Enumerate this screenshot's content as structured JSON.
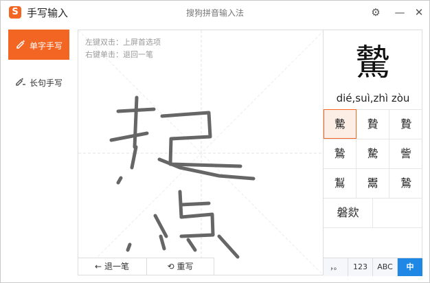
{
  "app": {
    "title": "手写输入",
    "logo": "S",
    "window_title": "搜狗拼音输入法"
  },
  "titlebar": {
    "settings_icon": "gear-icon",
    "minimize_icon": "minimize-icon",
    "close_icon": "close-icon",
    "minimize_glyph": "—",
    "close_glyph": "✕",
    "settings_glyph": "⚙"
  },
  "sidebar": {
    "items": [
      {
        "label": "单字手写",
        "icon": "pen-icon",
        "active": true
      },
      {
        "label": "长句手写",
        "icon": "sentence-pen-icon",
        "active": false
      }
    ]
  },
  "canvas": {
    "hints": [
      "左键双击：上屏首选项",
      "右键单击：退回一笔"
    ],
    "undo_label": "退一笔",
    "rewrite_label": "重写",
    "undo_glyph": "←",
    "rewrite_glyph": "⟲"
  },
  "result": {
    "preview_char": "驇",
    "pinyin": "dié,suì,zhì zòu"
  },
  "candidates": [
    [
      "驇",
      "贄",
      "贄"
    ],
    [
      "鷙",
      "騺",
      "訾"
    ],
    [
      "鵥",
      "鬻",
      "鷙"
    ],
    [
      "磐欻"
    ]
  ],
  "modes": [
    {
      "label": "，。",
      "active": false
    },
    {
      "label": "123",
      "active": false
    },
    {
      "label": "ABC",
      "active": false
    },
    {
      "label": "中",
      "active": true
    }
  ],
  "colors": {
    "accent": "#f26522",
    "mode_active": "#1f88e5",
    "ink": "#666666"
  }
}
